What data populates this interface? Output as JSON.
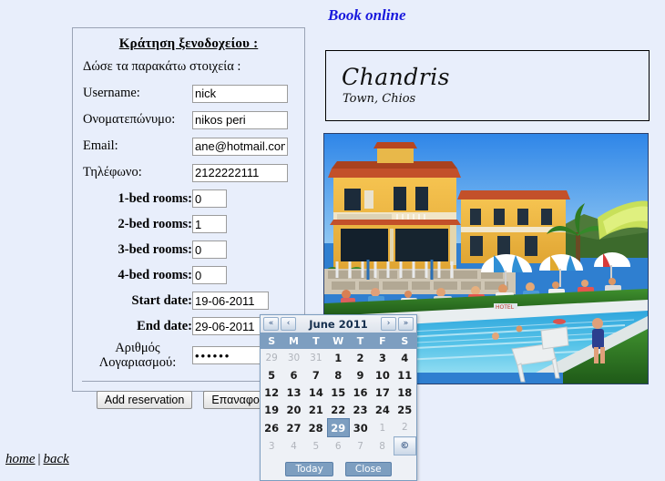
{
  "page": {
    "background_color": "#e8eefb",
    "book_online_title": "Book online",
    "accent_color": "#1919dd"
  },
  "form": {
    "title": "Κράτηση ξενοδοχείου :",
    "subtitle": "Δώσε τα παρακάτω στοιχεία :",
    "fields": [
      {
        "label": "Username:",
        "value": "nick"
      },
      {
        "label": "Ονοματεπώνυμο:",
        "value": "nikos peri"
      },
      {
        "label": "Email:",
        "value": "ane@hotmail.com"
      },
      {
        "label": "Τηλέφωνο:",
        "value": "2122222111"
      }
    ],
    "rooms": [
      {
        "label": "1-bed rooms:",
        "value": "0"
      },
      {
        "label": "2-bed rooms:",
        "value": "1"
      },
      {
        "label": "3-bed rooms:",
        "value": "0"
      },
      {
        "label": "4-bed rooms:",
        "value": "0"
      }
    ],
    "dates": [
      {
        "label": "Start date:",
        "value": "19-06-2011"
      },
      {
        "label": "End date:",
        "value": "29-06-2011"
      }
    ],
    "account": {
      "label_line1": "Αριθμός",
      "label_line2": "Λογαριασμού:",
      "value": "••••••"
    },
    "buttons": {
      "submit": "Add reservation",
      "reset": "Επαναφορά"
    }
  },
  "hotel": {
    "name": "Chandris",
    "location": "Town, Chios",
    "photo_alt": "hotel-pool-photo"
  },
  "calendar": {
    "title": "June 2011",
    "nav": {
      "prev_year": "«",
      "prev_month": "‹",
      "next_month": "›",
      "next_year": "»"
    },
    "weekdays": [
      "S",
      "M",
      "T",
      "W",
      "T",
      "F",
      "S"
    ],
    "selected_day": 29,
    "weeks": [
      [
        {
          "d": "29",
          "other": true
        },
        {
          "d": "30",
          "other": true
        },
        {
          "d": "31",
          "other": true
        },
        {
          "d": "1"
        },
        {
          "d": "2"
        },
        {
          "d": "3"
        },
        {
          "d": "4"
        }
      ],
      [
        {
          "d": "5"
        },
        {
          "d": "6"
        },
        {
          "d": "7"
        },
        {
          "d": "8"
        },
        {
          "d": "9"
        },
        {
          "d": "10"
        },
        {
          "d": "11"
        }
      ],
      [
        {
          "d": "12"
        },
        {
          "d": "13"
        },
        {
          "d": "14"
        },
        {
          "d": "15"
        },
        {
          "d": "16"
        },
        {
          "d": "17"
        },
        {
          "d": "18"
        }
      ],
      [
        {
          "d": "19"
        },
        {
          "d": "20"
        },
        {
          "d": "21"
        },
        {
          "d": "22"
        },
        {
          "d": "23"
        },
        {
          "d": "24"
        },
        {
          "d": "25"
        }
      ],
      [
        {
          "d": "26"
        },
        {
          "d": "27"
        },
        {
          "d": "28"
        },
        {
          "d": "29",
          "sel": true
        },
        {
          "d": "30"
        },
        {
          "d": "1",
          "other": true
        },
        {
          "d": "2",
          "other": true
        }
      ],
      [
        {
          "d": "3",
          "other": true
        },
        {
          "d": "4",
          "other": true
        },
        {
          "d": "5",
          "other": true
        },
        {
          "d": "6",
          "other": true
        },
        {
          "d": "7",
          "other": true
        },
        {
          "d": "8",
          "other": true
        },
        {
          "d": "©",
          "status": true
        }
      ]
    ],
    "footer": {
      "today": "Today",
      "close": "Close"
    },
    "header_color": "#7d9ec0"
  },
  "footer": {
    "home": "home",
    "divider": "|",
    "back": "back"
  }
}
